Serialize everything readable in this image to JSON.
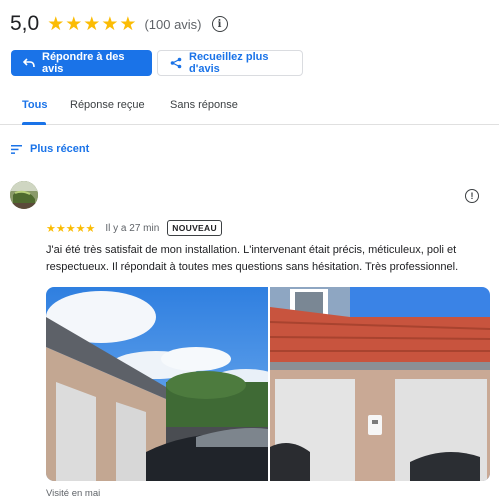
{
  "summary": {
    "score": "5,0",
    "stars": 5,
    "count_label": "(100 avis)",
    "info_icon": "info-icon"
  },
  "actions": {
    "reply_label": "Répondre à des avis",
    "collect_label": "Recueillez plus d'avis"
  },
  "tabs": [
    {
      "label": "Tous",
      "active": true
    },
    {
      "label": "Réponse reçue",
      "active": false
    },
    {
      "label": "Sans réponse",
      "active": false
    }
  ],
  "sort": {
    "label": "Plus récent",
    "icon": "sort-icon"
  },
  "review": {
    "stars": 5,
    "time": "Il y a 27 min",
    "badge": "NOUVEAU",
    "text": "J'ai été très satisfait de mon installation. L'intervenant était précis, méticuleux, poli et respectueux. Il répondait à toutes mes questions sans hésitation. Très professionnel.",
    "visited": "Visité en mai",
    "more_icon": "info-icon"
  },
  "colors": {
    "accent": "#1a73e8",
    "star": "#fbbc04",
    "text": "#202124",
    "muted": "#5f6368"
  }
}
